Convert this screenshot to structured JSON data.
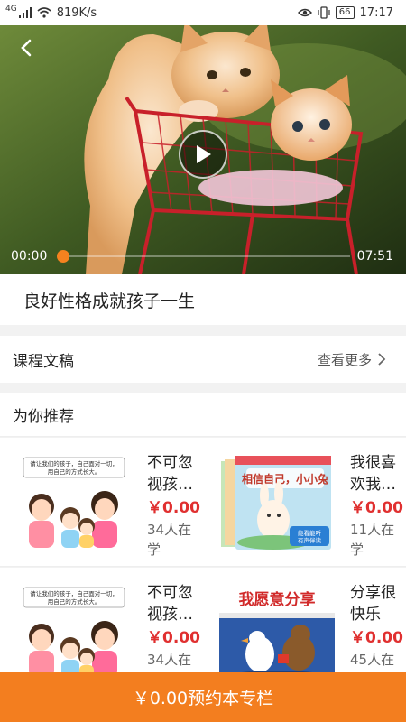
{
  "status_bar": {
    "network": "4G",
    "speed": "819K/s",
    "battery": "66",
    "time": "17:17",
    "icons": [
      "signal-icon",
      "wifi-icon",
      "eye-icon",
      "vibrate-icon",
      "battery-icon"
    ]
  },
  "player": {
    "current_time": "00:00",
    "total_time": "07:51",
    "progress": 0,
    "accent_color": "#f5821f"
  },
  "course": {
    "title": "良好性格成就孩子一生"
  },
  "transcript": {
    "label": "课程文稿",
    "see_more": "查看更多"
  },
  "recommend": {
    "header": "为你推荐",
    "items": [
      {
        "name": "不可忽视孩…",
        "price": "￥0.00",
        "learners": "34人在学",
        "thumb_caption": "请让我们的孩子，自己面对一切，用自己的方式长大。"
      },
      {
        "name": "我很喜欢我…",
        "price": "￥0.00",
        "learners": "11人在学",
        "thumb_title": "相信自己，小小兔",
        "thumb_badge": "能看能听 有声伴读"
      },
      {
        "name": "不可忽视孩…",
        "price": "￥0.00",
        "learners": "34人在学",
        "thumb_caption": "请让我们的孩子，自己面对一切，用自己的方式长大。"
      },
      {
        "name": "分享很快乐",
        "price": "￥0.00",
        "learners": "45人在学",
        "thumb_title": "我愿意分享"
      }
    ]
  },
  "cta": {
    "label": "￥0.00预约本专栏",
    "color": "#f37e1f"
  },
  "colors": {
    "price": "#e03030",
    "accent": "#f37e1f"
  }
}
